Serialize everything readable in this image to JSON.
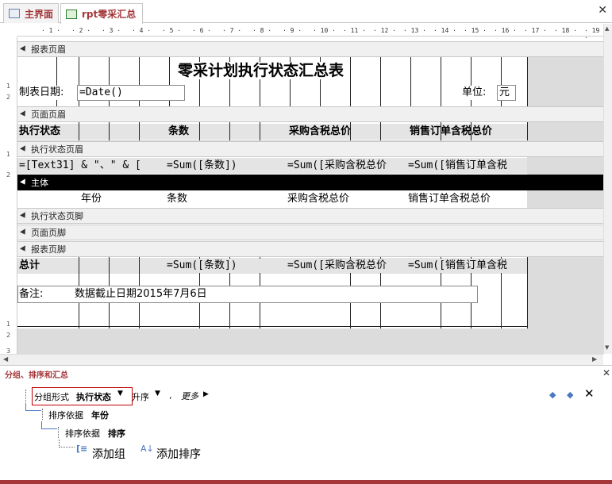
{
  "tabs": [
    {
      "label": "主界面",
      "icon": "form-icon"
    },
    {
      "label": "rpt零采汇总",
      "icon": "report-icon"
    }
  ],
  "ruler": {
    "h_ticks": [
      "1",
      "2",
      "3",
      "4",
      "5",
      "6",
      "7",
      "8",
      "9",
      "10",
      "11",
      "12",
      "13",
      "14",
      "15",
      "16",
      "17",
      "18",
      "19"
    ],
    "v_ticks": [
      "1",
      "2",
      "1",
      "2",
      "1",
      "2",
      "3"
    ]
  },
  "sections": {
    "report_header": "报表页眉",
    "page_header": "页面页眉",
    "group_header": "执行状态页眉",
    "detail": "主体",
    "group_footer": "执行状态页脚",
    "page_footer": "页面页脚",
    "report_footer": "报表页脚"
  },
  "report_header": {
    "title": "零采计划执行状态汇总表",
    "date_label": "制表日期:",
    "date_value": "=Date()",
    "unit_label": "单位:",
    "unit_value": "元"
  },
  "page_header": {
    "col1": "执行状态",
    "col2": "条数",
    "col3": "采购含税总价",
    "col4": "销售订单含税总价"
  },
  "group_header": {
    "c1": "=[Text31] & \"、\" & [",
    "c2": "=Sum([条数])",
    "c3": "=Sum([采购含税总价",
    "c4": "=Sum([销售订单含税"
  },
  "detail": {
    "c1": "年份",
    "c2": "条数",
    "c3": "采购含税总价",
    "c4": "销售订单含税总价"
  },
  "report_footer": {
    "total_label": "总计",
    "c2": "=Sum([条数])",
    "c3": "=Sum([采购含税总价",
    "c4": "=Sum([销售订单含税",
    "note_label": "备注:",
    "note_text": "数据截止日期2015年7月6日"
  },
  "group_pane": {
    "title": "分组、排序和汇总",
    "group_prefix": "分组形式",
    "group_field": "执行状态",
    "order": "升序",
    "more": "更多",
    "sort1_prefix": "排序依据",
    "sort1_field": "年份",
    "sort2_prefix": "排序依据",
    "sort2_field": "排序",
    "add_group": "添加组",
    "add_sort": "添加排序"
  },
  "colors": {
    "accent": "#a4373a",
    "highlight_box": "#c00000"
  }
}
